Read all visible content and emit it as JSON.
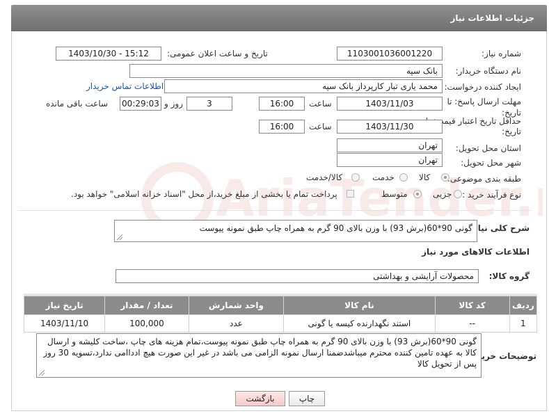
{
  "header": {
    "title": "جزئیات اطلاعات نیاز"
  },
  "fields": {
    "need_number_label": "شماره نیاز:",
    "need_number": "1103001036001220",
    "announce_label": "تاریخ و ساعت اعلان عمومی:",
    "announce_value": "1403/10/30 - 15:12",
    "buyer_label": "نام دستگاه خریدار:",
    "buyer_value": "بانک سپه",
    "creator_label": "ایجاد کننده درخواست:",
    "creator_value": "محمد یاری تبار کارپرداز بانک سپه",
    "contact_link": "اطلاعات تماس خریدار",
    "deadline_label_1": "مهلت ارسال پاسخ: تا",
    "deadline_label_2": "تاریخ:",
    "deadline_date": "1403/11/03",
    "time_label": "ساعت",
    "deadline_time": "16:00",
    "days_value": "3",
    "days_label": "روز و",
    "remaining_time": "00:29:03",
    "remaining_label": "ساعت باقی مانده",
    "validity_label_1": "حداقل تاریخ اعتبار قیمت: تا",
    "validity_label_2": "تاریخ:",
    "validity_date": "1403/11/30",
    "validity_time": "16:00",
    "province_label": "استان محل تحویل:",
    "province_value": "تهران",
    "city_label": "شهر محل تحویل:",
    "city_value": "تهران",
    "category_label": "طبقه بندی موضوعی:",
    "category_options": [
      "کالا",
      "خدمت",
      "کالا/خدمت"
    ],
    "process_label": "نوع فرآیند خرید :",
    "process_options": [
      "جزیی",
      "متوسط"
    ],
    "payment_note": "پرداخت تمام یا بخشی از مبلغ خرید،از محل \"اسناد خزانه اسلامی\" خواهد بود.",
    "summary_label": "شرح کلی نیاز:",
    "summary_value": "گونی 90*60(برش 93) با وزن بالای 90 گرم به همراه چاپ طبق نمونه پیوست",
    "items_title": "اطلاعات کالاهای مورد نیاز",
    "group_label": "گروه کالا:",
    "group_value": "محصولات آرایشی و بهداشتی",
    "buyer_notes_label": "توضیحات خریدار:",
    "buyer_notes": "گونی 90*60(برش 93) با وزن بالای 90 گرم به همراه چاپ طبق نمونه پیوست،تمام هزینه های چاپ ،ساخت کلیشه و ارسال کالا به عهده تامین کننده محترم میباشدضمنا ارسال نمونه الزامی می باشد  در غیر این صورت هیچ ادداامی ندارد،تسویه 30 روز پس از تحویل کالا"
  },
  "table": {
    "headers": [
      "ردیف",
      "کد کالا",
      "نام کالا",
      "واحد شمارش",
      "تعداد / مقدار",
      "تاریخ نیاز"
    ],
    "rows": [
      [
        "1",
        "--",
        "استند نگهدارنده کیسه یا گونی",
        "عدد",
        "100,000",
        "1403/11/10"
      ]
    ]
  },
  "buttons": {
    "print": "چاپ",
    "back": "بازگشت"
  },
  "watermark": "AriaTender.net"
}
